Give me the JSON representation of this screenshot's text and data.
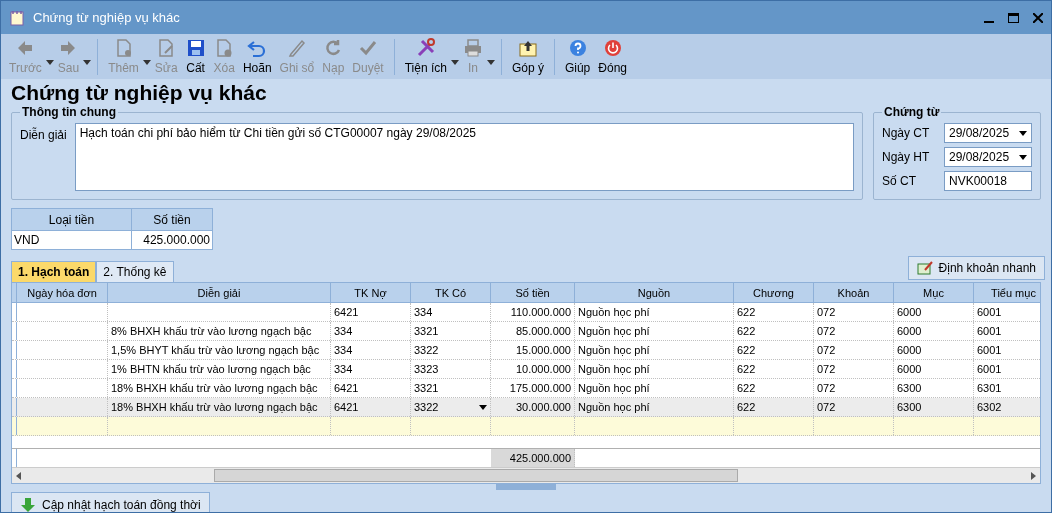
{
  "window": {
    "title": "Chứng từ nghiệp vụ khác"
  },
  "toolbar": [
    {
      "label": "Trước",
      "disabled": true,
      "dropdown": true
    },
    {
      "label": "Sau",
      "disabled": true,
      "dropdown": true
    },
    {
      "label": "Thêm",
      "disabled": true,
      "dropdown": true
    },
    {
      "label": "Sửa",
      "disabled": true,
      "dropdown": false
    },
    {
      "label": "Cất",
      "disabled": false,
      "dropdown": false
    },
    {
      "label": "Xóa",
      "disabled": true,
      "dropdown": false
    },
    {
      "label": "Hoãn",
      "disabled": false,
      "dropdown": false
    },
    {
      "label": "Ghi sổ",
      "disabled": true,
      "dropdown": false
    },
    {
      "label": "Nạp",
      "disabled": true,
      "dropdown": false
    },
    {
      "label": "Duyệt",
      "disabled": true,
      "dropdown": false
    },
    {
      "label": "Tiện ích",
      "disabled": false,
      "dropdown": true
    },
    {
      "label": "In",
      "disabled": true,
      "dropdown": true
    },
    {
      "label": "Góp ý",
      "disabled": false,
      "dropdown": false
    },
    {
      "label": "Giúp",
      "disabled": false,
      "dropdown": false
    },
    {
      "label": "Đóng",
      "disabled": false,
      "dropdown": false
    }
  ],
  "heading": "Chứng từ nghiệp vụ khác",
  "general": {
    "title": "Thông tin chung",
    "label": "Diễn giải",
    "value": "Hạch toán chi phí bảo hiểm từ Chi tiền gửi số CTG00007 ngày 29/08/2025"
  },
  "voucher": {
    "title": "Chứng từ",
    "fields": [
      {
        "label": "Ngày CT",
        "value": "29/08/2025",
        "kind": "date"
      },
      {
        "label": "Ngày HT",
        "value": "29/08/2025",
        "kind": "date"
      },
      {
        "label": "Số CT",
        "value": "NVK00018",
        "kind": "text"
      }
    ]
  },
  "currency": {
    "columns": [
      "Loại tiền",
      "Số tiền"
    ],
    "row": [
      "VND",
      "425.000.000"
    ]
  },
  "tabs": [
    {
      "label": "1. Hạch toán",
      "selected": true
    },
    {
      "label": "2. Thống kê",
      "selected": false
    }
  ],
  "quick_button": "Định khoản nhanh",
  "table": {
    "columns": [
      "Ngày hóa đơn",
      "Diễn giải",
      "TK Nợ",
      "TK Có",
      "Số tiền",
      "Nguồn",
      "Chương",
      "Khoản",
      "Mục",
      "Tiểu mục"
    ],
    "rows": [
      {
        "selected": false,
        "cells": {
          "debit": "6421",
          "credit": "334",
          "amount": "110.000.000",
          "source": "Nguồn học phí",
          "chapter": "622",
          "item": "072",
          "section": "6000",
          "subsection": "6001"
        }
      },
      {
        "selected": false,
        "cells": {
          "description": "8% BHXH khấu trừ vào lương ngạch bậc",
          "debit": "334",
          "credit": "3321",
          "amount": "85.000.000",
          "source": "Nguồn học phí",
          "chapter": "622",
          "item": "072",
          "section": "6000",
          "subsection": "6001"
        }
      },
      {
        "selected": false,
        "cells": {
          "description": "1,5% BHYT khấu trừ vào lương ngạch bậc",
          "debit": "334",
          "credit": "3322",
          "amount": "15.000.000",
          "source": "Nguồn học phí",
          "chapter": "622",
          "item": "072",
          "section": "6000",
          "subsection": "6001"
        }
      },
      {
        "selected": false,
        "cells": {
          "description": "1% BHTN  khấu trừ vào lương ngạch bậc",
          "debit": "334",
          "credit": "3323",
          "amount": "10.000.000",
          "source": "Nguồn học phí",
          "chapter": "622",
          "item": "072",
          "section": "6000",
          "subsection": "6001"
        }
      },
      {
        "selected": false,
        "cells": {
          "description": "18% BHXH khấu trừ vào lương ngạch bậc",
          "debit": "6421",
          "credit": "3321",
          "amount": "175.000.000",
          "source": "Nguồn học phí",
          "chapter": "622",
          "item": "072",
          "section": "6300",
          "subsection": "6301"
        }
      },
      {
        "selected": true,
        "cells": {
          "description": "18% BHXH khấu trừ vào lương ngạch bậc",
          "debit": "6421",
          "credit": "3322",
          "amount": "30.000.000",
          "source": "Nguồn học phí",
          "chapter": "622",
          "item": "072",
          "section": "6300",
          "subsection": "6302"
        }
      }
    ],
    "total": "425.000.000"
  },
  "update_button": "Cập nhật hạch toán đồng thời"
}
